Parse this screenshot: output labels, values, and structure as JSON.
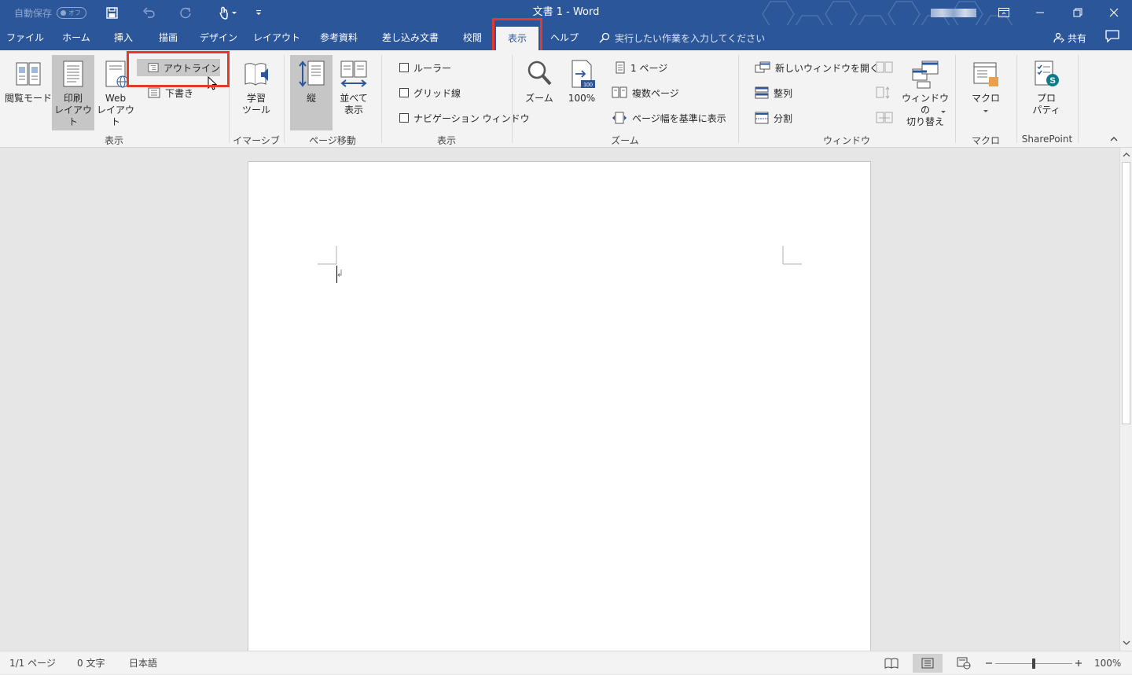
{
  "titlebar": {
    "autosave_label": "自動保存",
    "autosave_state": "オフ",
    "doc_title": "文書 1  -  Word"
  },
  "tabs": [
    {
      "label": "ファイル"
    },
    {
      "label": "ホーム"
    },
    {
      "label": "挿入"
    },
    {
      "label": "描画"
    },
    {
      "label": "デザイン"
    },
    {
      "label": "レイアウト"
    },
    {
      "label": "参考資料"
    },
    {
      "label": "差し込み文書"
    },
    {
      "label": "校閲"
    },
    {
      "label": "表示",
      "active": true
    },
    {
      "label": "ヘルプ"
    }
  ],
  "tellme": "実行したい作業を入力してください",
  "share_label": "共有",
  "ribbon": {
    "views": {
      "reading_mode": "閲覧モード",
      "print_layout": [
        "印刷",
        "レイアウト"
      ],
      "web_layout": [
        "Web",
        "レイアウト"
      ],
      "outline": "アウトライン",
      "draft": "下書き",
      "group_label": "表示"
    },
    "immersive": {
      "learning_tools": [
        "学習",
        "ツール"
      ],
      "group_label": "イマーシブ"
    },
    "page_movement": {
      "vertical": "縦",
      "side_by_side": [
        "並べて",
        "表示"
      ],
      "group_label": "ページ移動"
    },
    "show": {
      "ruler": "ルーラー",
      "gridlines": "グリッド線",
      "navigation_pane": "ナビゲーション ウィンドウ",
      "group_label": "表示"
    },
    "zoom": {
      "zoom": "ズーム",
      "hundred": "100%",
      "one_page": "1 ページ",
      "multiple_pages": "複数ページ",
      "page_width": "ページ幅を基準に表示",
      "group_label": "ズーム"
    },
    "window": {
      "new_window": "新しいウィンドウを開く",
      "arrange_all": "整列",
      "split": "分割",
      "switch_windows": [
        "ウィンドウの",
        "切り替え"
      ],
      "group_label": "ウィンドウ"
    },
    "macros": {
      "macros": "マクロ",
      "group_label": "マクロ"
    },
    "sharepoint": {
      "properties": [
        "プロ",
        "パティ"
      ],
      "group_label": "SharePoint"
    }
  },
  "status": {
    "page": "1/1 ページ",
    "words": "0 文字",
    "language": "日本語",
    "zoom_level": "100%",
    "zoom_slider_fraction": 0.5
  },
  "colors": {
    "brand": "#2b579a",
    "highlight_box": "#e23a2b"
  }
}
